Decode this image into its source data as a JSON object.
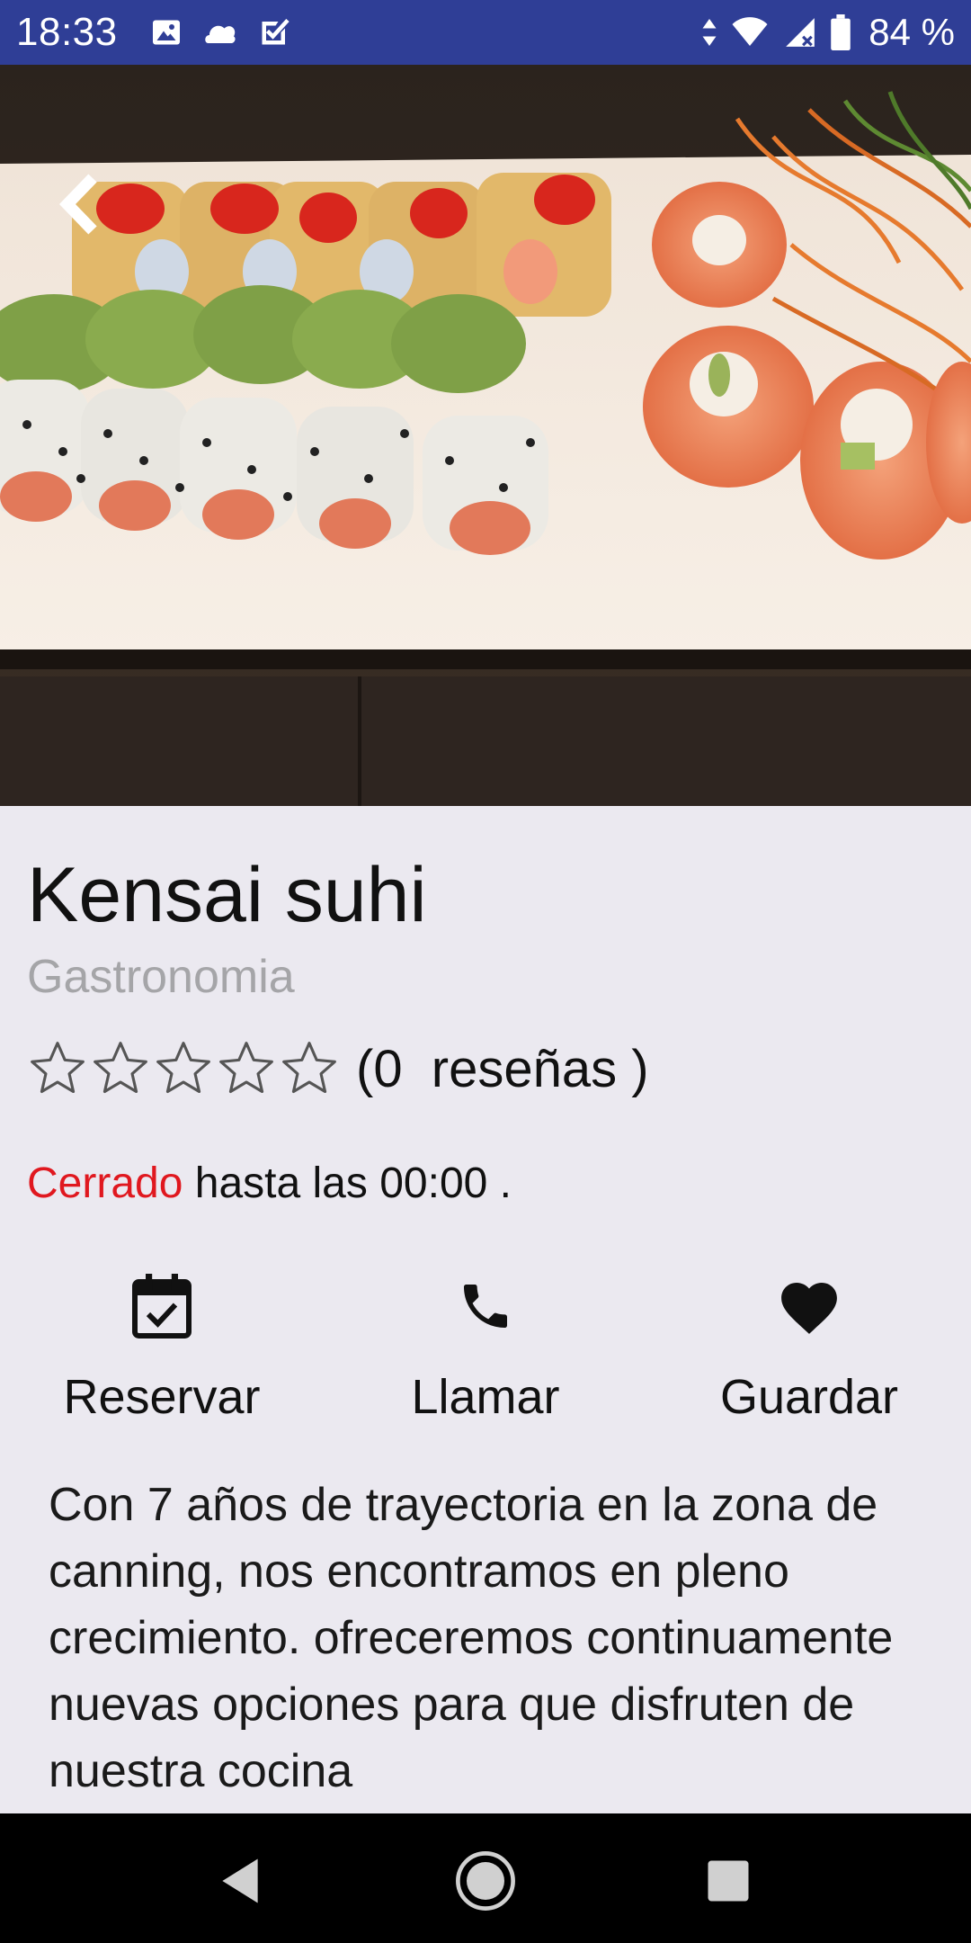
{
  "status_bar": {
    "time": "18:33",
    "battery_percent": "84 %",
    "icons_left": [
      "image-icon",
      "cloud-icon",
      "checkbox-icon"
    ],
    "icons_right": [
      "data-arrows-icon",
      "wifi-icon",
      "signal-icon",
      "battery-icon"
    ],
    "color": "#2f3e96"
  },
  "hero": {
    "image": "sushi-platter-photo",
    "back_icon": "chevron-left-icon"
  },
  "place": {
    "name": "Kensai suhi",
    "category": "Gastronomia",
    "rating_stars": 0,
    "rating_max": 5,
    "reviews_text": "(0  reseñas )",
    "status_closed": "Cerrado",
    "status_rest": " hasta las 00:00 ."
  },
  "actions": [
    {
      "label": "Reservar",
      "icon": "calendar-check-icon"
    },
    {
      "label": "Llamar",
      "icon": "phone-icon"
    },
    {
      "label": "Guardar",
      "icon": "heart-icon"
    }
  ],
  "description": "Con 7 años de trayectoria en la zona de canning, nos encontramos en pleno crecimiento. ofreceremos continuamente nuevas opciones para que disfruten de nuestra cocina",
  "nav_bar": {
    "buttons": [
      "back-triangle-icon",
      "home-circle-icon",
      "recents-square-icon"
    ]
  },
  "colors": {
    "closed": "#e0181f",
    "category": "#a5a5a8",
    "background": "#ebe9f0"
  }
}
